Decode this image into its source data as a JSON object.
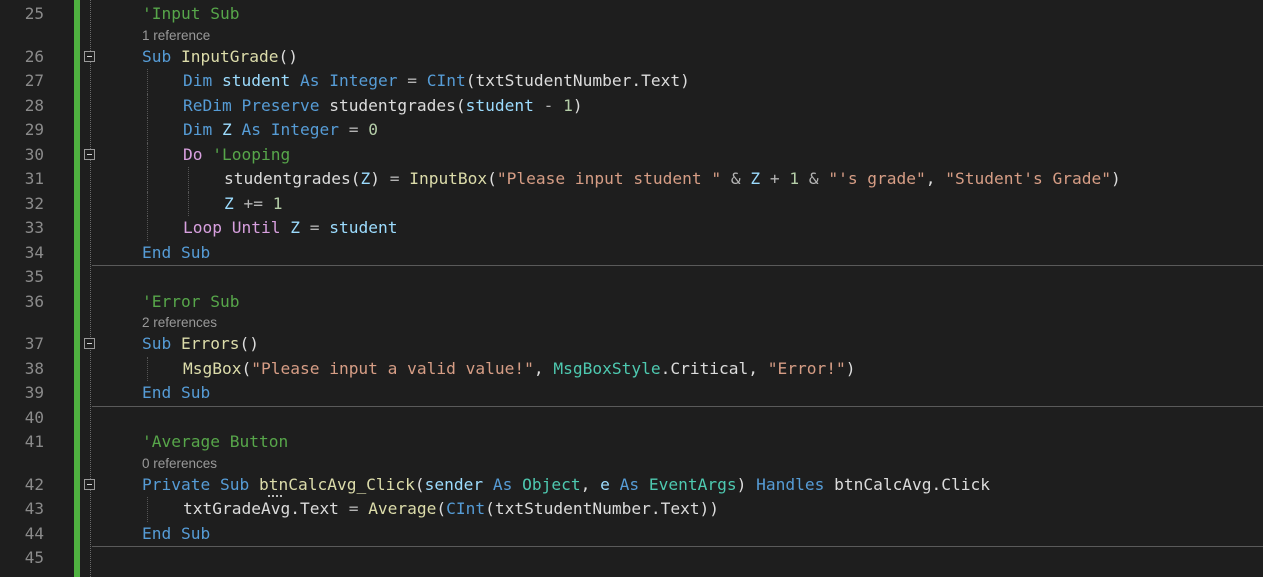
{
  "editor": {
    "colors": {
      "background": "#1e1e1e",
      "change_bar": "#4fb140",
      "keyword": "#569cd6",
      "comment": "#57a64a",
      "string": "#d69d85"
    },
    "lines": [
      {
        "n": "25",
        "tokens": [
          [
            "cm",
            "'Input Sub"
          ]
        ]
      },
      {
        "n": "26",
        "fold": true,
        "lens": "1 reference",
        "tokens": [
          [
            "kw",
            "Sub"
          ],
          [
            "id",
            " "
          ],
          [
            "fn",
            "InputGrade"
          ],
          [
            "id",
            "()"
          ]
        ]
      },
      {
        "n": "27",
        "indent": 1,
        "tokens": [
          [
            "kw",
            "Dim"
          ],
          [
            "id",
            " "
          ],
          [
            "prm",
            "student"
          ],
          [
            "id",
            " "
          ],
          [
            "kw",
            "As"
          ],
          [
            "id",
            " "
          ],
          [
            "kw",
            "Integer"
          ],
          [
            "id",
            " "
          ],
          [
            "op",
            "="
          ],
          [
            "id",
            " "
          ],
          [
            "kw",
            "CInt"
          ],
          [
            "id",
            "(txtStudentNumber.Text)"
          ]
        ]
      },
      {
        "n": "28",
        "indent": 1,
        "tokens": [
          [
            "kw",
            "ReDim"
          ],
          [
            "id",
            " "
          ],
          [
            "kw",
            "Preserve"
          ],
          [
            "id",
            " studentgrades("
          ],
          [
            "prm",
            "student"
          ],
          [
            "id",
            " "
          ],
          [
            "op",
            "-"
          ],
          [
            "id",
            " "
          ],
          [
            "num",
            "1"
          ],
          [
            "id",
            ")"
          ]
        ]
      },
      {
        "n": "29",
        "indent": 1,
        "tokens": [
          [
            "kw",
            "Dim"
          ],
          [
            "id",
            " "
          ],
          [
            "prm",
            "Z"
          ],
          [
            "id",
            " "
          ],
          [
            "kw",
            "As"
          ],
          [
            "id",
            " "
          ],
          [
            "kw",
            "Integer"
          ],
          [
            "id",
            " "
          ],
          [
            "op",
            "="
          ],
          [
            "id",
            " "
          ],
          [
            "num",
            "0"
          ]
        ]
      },
      {
        "n": "30",
        "indent": 1,
        "fold": true,
        "tokens": [
          [
            "ctl",
            "Do"
          ],
          [
            "id",
            " "
          ],
          [
            "cm",
            "'Looping"
          ]
        ]
      },
      {
        "n": "31",
        "indent": 2,
        "tokens": [
          [
            "id",
            "studentgrades("
          ],
          [
            "prm",
            "Z"
          ],
          [
            "id",
            ") "
          ],
          [
            "op",
            "="
          ],
          [
            "id",
            " "
          ],
          [
            "fn",
            "InputBox"
          ],
          [
            "id",
            "("
          ],
          [
            "str",
            "\"Please input student \""
          ],
          [
            "id",
            " "
          ],
          [
            "op",
            "&"
          ],
          [
            "id",
            " "
          ],
          [
            "prm",
            "Z"
          ],
          [
            "id",
            " "
          ],
          [
            "op",
            "+"
          ],
          [
            "id",
            " "
          ],
          [
            "num",
            "1"
          ],
          [
            "id",
            " "
          ],
          [
            "op",
            "&"
          ],
          [
            "id",
            " "
          ],
          [
            "str",
            "\"'s grade\""
          ],
          [
            "id",
            ", "
          ],
          [
            "str",
            "\"Student's Grade\""
          ],
          [
            "id",
            ")"
          ]
        ]
      },
      {
        "n": "32",
        "indent": 2,
        "tokens": [
          [
            "prm",
            "Z"
          ],
          [
            "id",
            " "
          ],
          [
            "op",
            "+="
          ],
          [
            "id",
            " "
          ],
          [
            "num",
            "1"
          ]
        ]
      },
      {
        "n": "33",
        "indent": 1,
        "tokens": [
          [
            "ctl",
            "Loop"
          ],
          [
            "id",
            " "
          ],
          [
            "ctl",
            "Until"
          ],
          [
            "id",
            " "
          ],
          [
            "prm",
            "Z"
          ],
          [
            "id",
            " "
          ],
          [
            "op",
            "="
          ],
          [
            "id",
            " "
          ],
          [
            "prm",
            "student"
          ]
        ]
      },
      {
        "n": "34",
        "tokens": [
          [
            "kw",
            "End"
          ],
          [
            "id",
            " "
          ],
          [
            "kw",
            "Sub"
          ]
        ]
      },
      {
        "n": "35",
        "tokens": []
      },
      {
        "n": "36",
        "tokens": [
          [
            "cm",
            "'Error Sub"
          ]
        ]
      },
      {
        "n": "37",
        "fold": true,
        "lens": "2 references",
        "tokens": [
          [
            "kw",
            "Sub"
          ],
          [
            "id",
            " "
          ],
          [
            "fn",
            "Errors"
          ],
          [
            "id",
            "()"
          ]
        ]
      },
      {
        "n": "38",
        "indent": 1,
        "tokens": [
          [
            "fn",
            "MsgBox"
          ],
          [
            "id",
            "("
          ],
          [
            "str",
            "\"Please input a valid value!\""
          ],
          [
            "id",
            ", "
          ],
          [
            "ty",
            "MsgBoxStyle"
          ],
          [
            "id",
            "."
          ],
          [
            "id",
            "Critical, "
          ],
          [
            "str",
            "\"Error!\""
          ],
          [
            "id",
            ")"
          ]
        ]
      },
      {
        "n": "39",
        "tokens": [
          [
            "kw",
            "End"
          ],
          [
            "id",
            " "
          ],
          [
            "kw",
            "Sub"
          ]
        ]
      },
      {
        "n": "40",
        "tokens": []
      },
      {
        "n": "41",
        "tokens": [
          [
            "cm",
            "'Average Button"
          ]
        ]
      },
      {
        "n": "42",
        "fold": true,
        "lens": "0 references",
        "tokens": [
          [
            "kw",
            "Private"
          ],
          [
            "id",
            " "
          ],
          [
            "kw",
            "Sub"
          ],
          [
            "id",
            " "
          ],
          [
            "fn",
            "btnCalcAvg_Click"
          ],
          [
            "id",
            "("
          ],
          [
            "prm",
            "sender"
          ],
          [
            "id",
            " "
          ],
          [
            "kw",
            "As"
          ],
          [
            "id",
            " "
          ],
          [
            "ty",
            "Object"
          ],
          [
            "id",
            ", "
          ],
          [
            "prm",
            "e"
          ],
          [
            "id",
            " "
          ],
          [
            "kw",
            "As"
          ],
          [
            "id",
            " "
          ],
          [
            "ty",
            "EventArgs"
          ],
          [
            "id",
            ") "
          ],
          [
            "kw",
            "Handles"
          ],
          [
            "id",
            " btnCalcAvg.Click"
          ]
        ]
      },
      {
        "n": "43",
        "indent": 1,
        "tokens": [
          [
            "id",
            "txtGradeAvg.Text "
          ],
          [
            "op",
            "="
          ],
          [
            "id",
            " "
          ],
          [
            "fn",
            "Average"
          ],
          [
            "id",
            "("
          ],
          [
            "kw",
            "CInt"
          ],
          [
            "id",
            "(txtStudentNumber.Text))"
          ]
        ]
      },
      {
        "n": "44",
        "tokens": [
          [
            "kw",
            "End"
          ],
          [
            "id",
            " "
          ],
          [
            "kw",
            "Sub"
          ]
        ]
      },
      {
        "n": "45",
        "tokens": []
      }
    ]
  }
}
